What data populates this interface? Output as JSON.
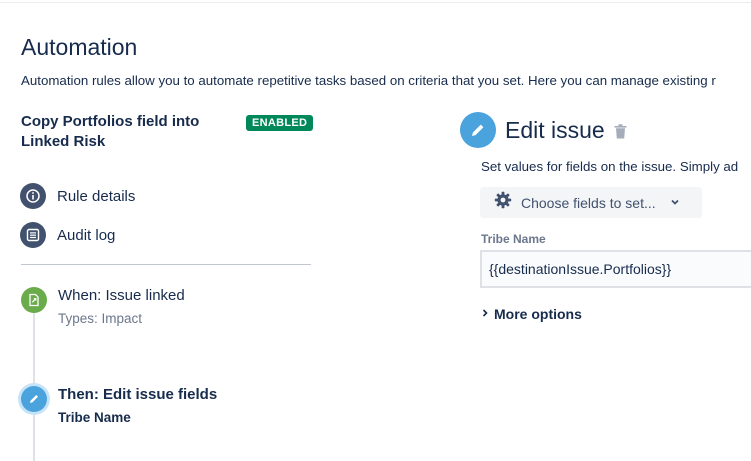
{
  "page": {
    "title": "Automation",
    "description": "Automation rules allow you to automate repetitive tasks based on criteria that you set. Here you can manage existing r"
  },
  "rule": {
    "title": "Copy Portfolios field into Linked Risk",
    "status_badge": "ENABLED"
  },
  "nav": {
    "items": [
      {
        "label": "Rule details",
        "icon": "info-icon"
      },
      {
        "label": "Audit log",
        "icon": "list-icon"
      }
    ]
  },
  "steps": [
    {
      "title": "When: Issue linked",
      "subtitle": "Types: Impact",
      "icon": "trigger-icon",
      "color": "#6aac4c"
    },
    {
      "title": "Then: Edit issue fields",
      "subtitle": "Tribe Name",
      "icon": "pencil-icon",
      "color": "#4ba3dd"
    }
  ],
  "editor": {
    "title": "Edit issue",
    "description": "Set values for fields on the issue. Simply ad",
    "choose_fields_label": "Choose fields to set...",
    "field_label": "Tribe Name",
    "field_value": "{{destinationIssue.Portfolios}}",
    "more_options_label": "More options"
  },
  "colors": {
    "text": "#172b4d",
    "badge_green": "#00875a",
    "nav_icon": "#42526e",
    "edit_blue": "#4ba3dd",
    "trigger_green": "#6aac4c"
  }
}
